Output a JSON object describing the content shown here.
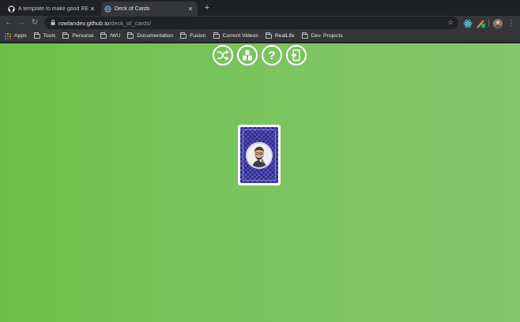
{
  "tabs": [
    {
      "title": "A template to make good REA",
      "icon": "github-icon",
      "active": false
    },
    {
      "title": "Deck of Cards",
      "icon": "globe-icon",
      "active": true
    }
  ],
  "new_tab_label": "+",
  "address": {
    "host": "rowlandev.github.io",
    "path": "/deck_of_cards/"
  },
  "bookmarks": [
    {
      "label": "Apps",
      "icon": "apps-grid-icon"
    },
    {
      "label": "Tools",
      "icon": "folder-icon"
    },
    {
      "label": "Personal",
      "icon": "folder-icon"
    },
    {
      "label": "IWU",
      "icon": "folder-icon"
    },
    {
      "label": "Documentation",
      "icon": "folder-icon"
    },
    {
      "label": "Fusion",
      "icon": "folder-icon"
    },
    {
      "label": "Current Videos",
      "icon": "folder-icon"
    },
    {
      "label": "RealLife",
      "icon": "folder-icon"
    },
    {
      "label": "Dev. Projects",
      "icon": "folder-icon"
    }
  ],
  "controls": [
    {
      "name": "shuffle-button",
      "icon": "shuffle-icon"
    },
    {
      "name": "stack-button",
      "icon": "stack-icon"
    },
    {
      "name": "help-button",
      "icon": "question-mark-icon",
      "glyph": "?"
    },
    {
      "name": "exit-button",
      "icon": "exit-door-icon"
    }
  ],
  "card": {
    "face": "back",
    "pattern": "blue-diamond",
    "center": "portrait"
  },
  "colors": {
    "page_green": "#6cc04a",
    "card_back": "#2e2c96",
    "tab_bar": "#202124",
    "toolbar": "#35363a"
  }
}
